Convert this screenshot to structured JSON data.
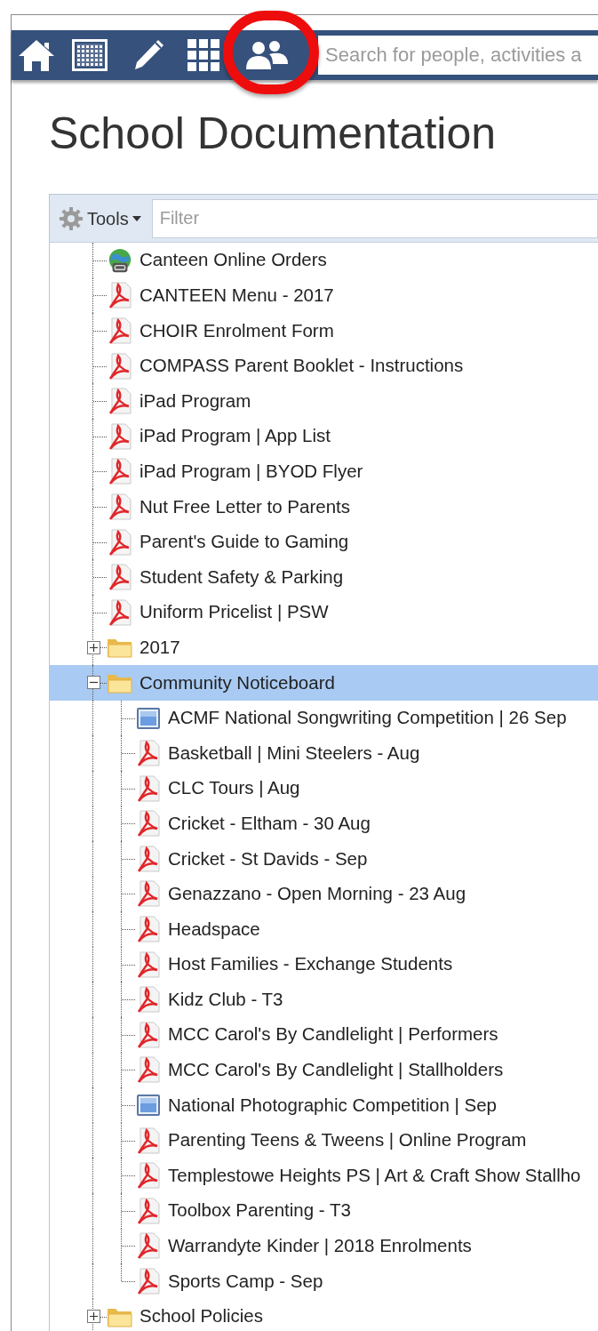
{
  "nav": {
    "items": [
      {
        "kind": "home",
        "selected": false
      },
      {
        "kind": "calendar",
        "selected": false
      },
      {
        "kind": "pencil",
        "selected": false
      },
      {
        "kind": "grid",
        "selected": false
      },
      {
        "kind": "people",
        "selected": false
      }
    ],
    "search": {
      "placeholder": "Search for people, activities a"
    }
  },
  "page": {
    "title": "School Documentation"
  },
  "toolbar": {
    "tools_label": "Tools",
    "filter": {
      "placeholder": "Filter"
    }
  },
  "tree": [
    {
      "kind": "link",
      "label": "Canteen Online Orders",
      "selected": false
    },
    {
      "kind": "pdf",
      "label": "CANTEEN Menu - 2017",
      "selected": false
    },
    {
      "kind": "pdf",
      "label": "CHOIR Enrolment Form",
      "selected": false
    },
    {
      "kind": "pdf",
      "label": "COMPASS Parent Booklet - Instructions",
      "selected": false
    },
    {
      "kind": "pdf",
      "label": "iPad Program",
      "selected": false
    },
    {
      "kind": "pdf",
      "label": "iPad Program | App List",
      "selected": false
    },
    {
      "kind": "pdf",
      "label": "iPad Program | BYOD Flyer",
      "selected": false
    },
    {
      "kind": "pdf",
      "label": "Nut Free Letter to Parents",
      "selected": false
    },
    {
      "kind": "pdf",
      "label": "Parent's Guide to Gaming",
      "selected": false
    },
    {
      "kind": "pdf",
      "label": "Student Safety & Parking",
      "selected": false
    },
    {
      "kind": "pdf",
      "label": "Uniform Pricelist | PSW",
      "selected": false
    },
    {
      "kind": "folder",
      "label": "2017",
      "selected": false,
      "expanded": false
    },
    {
      "kind": "folder",
      "label": "Community Noticeboard",
      "selected": true,
      "expanded": true,
      "children": [
        {
          "kind": "image",
          "label": "ACMF National Songwriting Competition | 26 Sep",
          "selected": false
        },
        {
          "kind": "pdf",
          "label": "Basketball | Mini Steelers - Aug",
          "selected": false
        },
        {
          "kind": "pdf",
          "label": "CLC Tours | Aug",
          "selected": false
        },
        {
          "kind": "pdf",
          "label": "Cricket - Eltham - 30 Aug",
          "selected": false
        },
        {
          "kind": "pdf",
          "label": "Cricket - St Davids - Sep",
          "selected": false
        },
        {
          "kind": "pdf",
          "label": "Genazzano - Open Morning - 23 Aug",
          "selected": false
        },
        {
          "kind": "pdf",
          "label": "Headspace",
          "selected": false
        },
        {
          "kind": "pdf",
          "label": "Host Families - Exchange Students",
          "selected": false
        },
        {
          "kind": "pdf",
          "label": "Kidz Club - T3",
          "selected": false
        },
        {
          "kind": "pdf",
          "label": "MCC Carol's By Candlelight | Performers",
          "selected": false
        },
        {
          "kind": "pdf",
          "label": "MCC Carol's By Candlelight | Stallholders",
          "selected": false
        },
        {
          "kind": "image",
          "label": "National Photographic Competition | Sep",
          "selected": false
        },
        {
          "kind": "pdf",
          "label": "Parenting Teens & Tweens | Online Program",
          "selected": false
        },
        {
          "kind": "pdf",
          "label": "Templestowe Heights PS | Art & Craft Show Stallho",
          "selected": false
        },
        {
          "kind": "pdf",
          "label": "Toolbox Parenting - T3",
          "selected": false
        },
        {
          "kind": "pdf",
          "label": "Warrandyte Kinder | 2018 Enrolments",
          "selected": false
        },
        {
          "kind": "pdf",
          "label": "Sports Camp - Sep",
          "selected": false
        }
      ]
    },
    {
      "kind": "folder",
      "label": "School Policies",
      "selected": false,
      "expanded": false
    }
  ]
}
